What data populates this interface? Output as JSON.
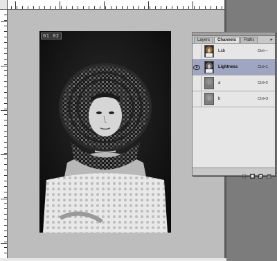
{
  "document": {
    "zoom_label": "01.02"
  },
  "palette": {
    "tabs": [
      {
        "label": "Layers",
        "active": false
      },
      {
        "label": "Channels",
        "active": true
      },
      {
        "label": "Paths",
        "active": false
      }
    ],
    "menu_icon": "triangle-right-icon",
    "channels": [
      {
        "name": "Lab",
        "shortcut": "Ctrl+~",
        "visible": false,
        "selected": false
      },
      {
        "name": "Lightness",
        "shortcut": "Ctrl+1",
        "visible": true,
        "selected": true
      },
      {
        "name": "a",
        "shortcut": "Ctrl+2",
        "visible": false,
        "selected": false
      },
      {
        "name": "b",
        "shortcut": "Ctrl+3",
        "visible": false,
        "selected": false
      }
    ],
    "footer_icons": [
      "load-selection-icon",
      "save-selection-icon",
      "new-channel-icon",
      "trash-icon"
    ]
  },
  "colors": {
    "selected_row": "#9fa6c2",
    "workspace": "#7c7c7c",
    "canvas_bg": "#bdbdbd"
  }
}
